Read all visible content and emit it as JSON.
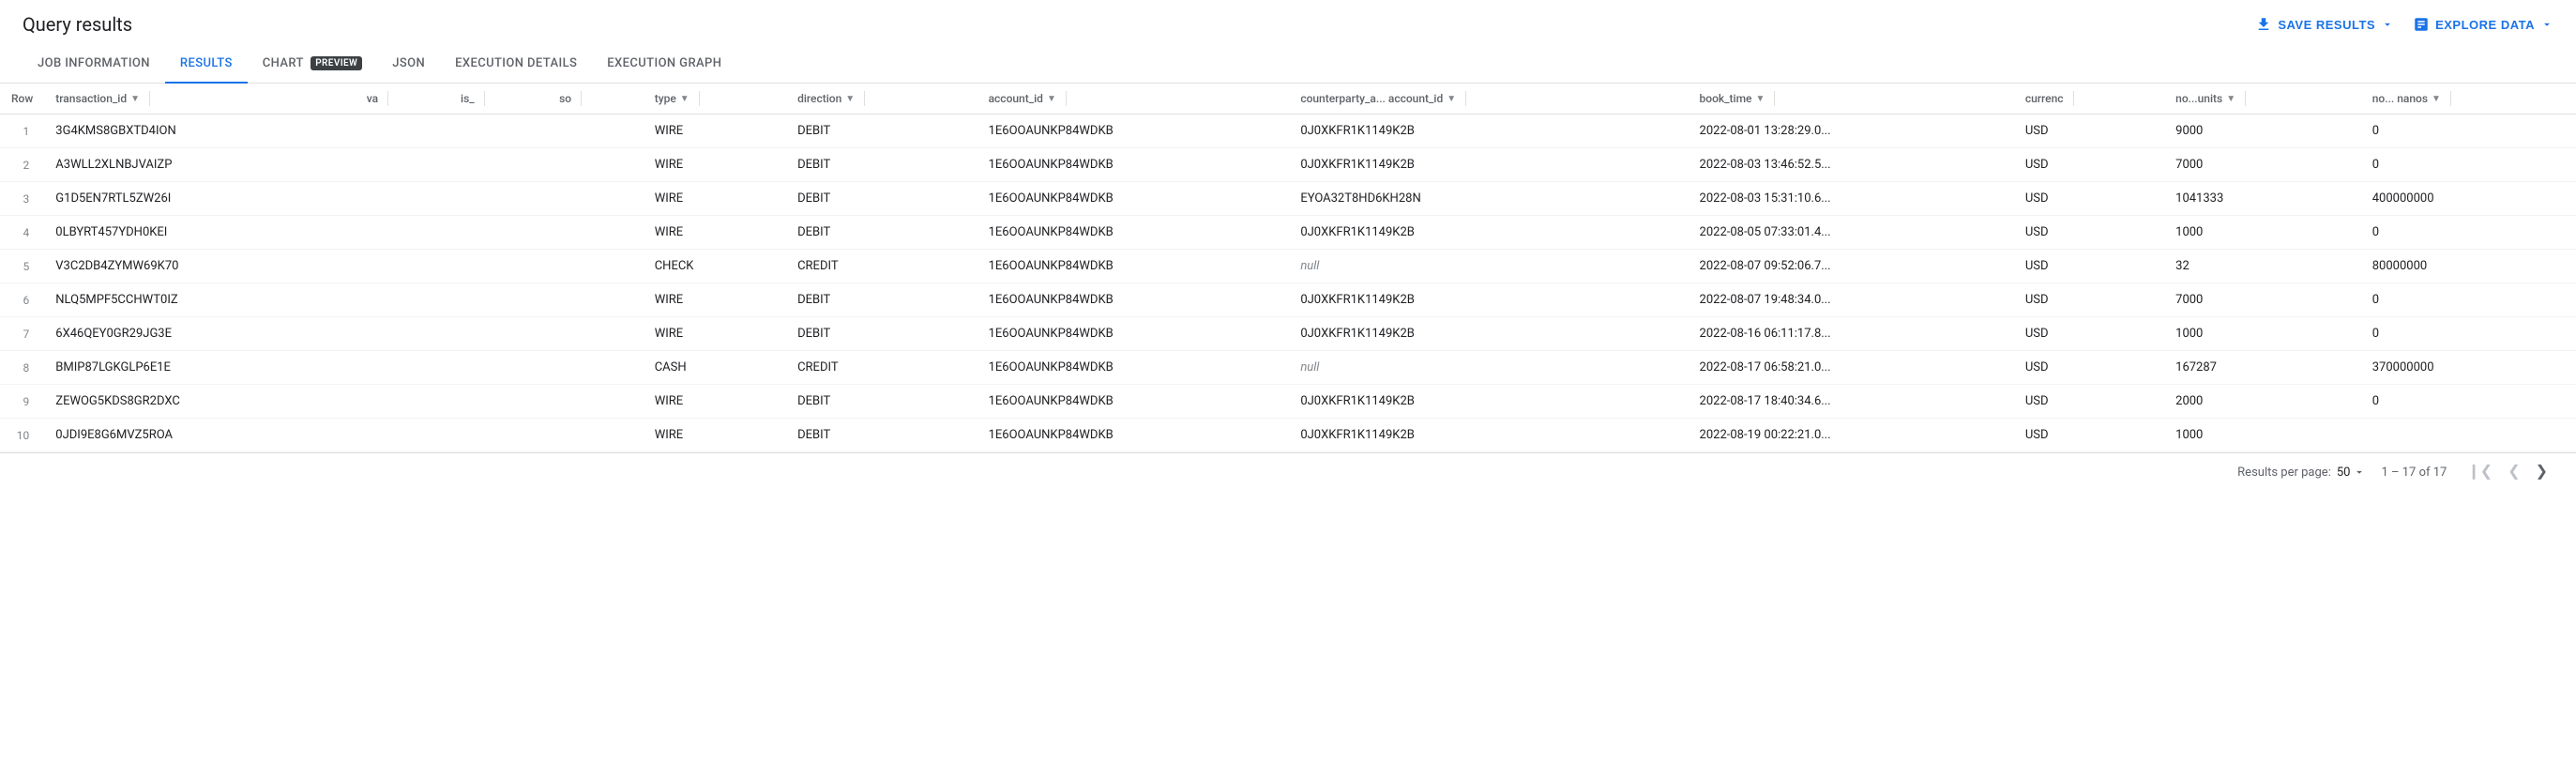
{
  "page": {
    "title": "Query results"
  },
  "header": {
    "save_results_label": "SAVE RESULTS",
    "explore_data_label": "EXPLORE DATA"
  },
  "tabs": [
    {
      "id": "job-information",
      "label": "JOB INFORMATION",
      "active": false,
      "preview": false
    },
    {
      "id": "results",
      "label": "RESULTS",
      "active": true,
      "preview": false
    },
    {
      "id": "chart",
      "label": "CHART",
      "active": false,
      "preview": true
    },
    {
      "id": "json",
      "label": "JSON",
      "active": false,
      "preview": false
    },
    {
      "id": "execution-details",
      "label": "EXECUTION DETAILS",
      "active": false,
      "preview": false
    },
    {
      "id": "execution-graph",
      "label": "EXECUTION GRAPH",
      "active": false,
      "preview": false
    }
  ],
  "table": {
    "columns": [
      {
        "id": "row",
        "label": "Row",
        "sortable": false
      },
      {
        "id": "transaction_id",
        "label": "transaction_id",
        "sortable": true
      },
      {
        "id": "va",
        "label": "va",
        "sortable": false
      },
      {
        "id": "is_",
        "label": "is_",
        "sortable": false
      },
      {
        "id": "so",
        "label": "so",
        "sortable": false
      },
      {
        "id": "type",
        "label": "type",
        "sortable": true
      },
      {
        "id": "direction",
        "label": "direction",
        "sortable": true
      },
      {
        "id": "account_id",
        "label": "account_id",
        "sortable": true
      },
      {
        "id": "counterparty_a_account_id",
        "label": "counterparty_a... account_id",
        "sortable": true
      },
      {
        "id": "book_time",
        "label": "book_time",
        "sortable": true
      },
      {
        "id": "currency",
        "label": "currenc",
        "sortable": false
      },
      {
        "id": "no_units",
        "label": "no...units",
        "sortable": true
      },
      {
        "id": "no_nanos",
        "label": "no... nanos",
        "sortable": true
      }
    ],
    "rows": [
      {
        "row": 1,
        "transaction_id": "3G4KMS8GBXTD4ION",
        "va": "",
        "is_": "",
        "so": "",
        "type": "WIRE",
        "direction": "DEBIT",
        "account_id": "1E6OOAUNKP84WDKB",
        "counterparty_a_account_id": "0J0XKFR1K1149K2B",
        "book_time": "2022-08-01 13:28:29.0...",
        "currency": "USD",
        "no_units": "9000",
        "no_nanos": "0"
      },
      {
        "row": 2,
        "transaction_id": "A3WLL2XLNBJVAIZP",
        "va": "",
        "is_": "",
        "so": "",
        "type": "WIRE",
        "direction": "DEBIT",
        "account_id": "1E6OOAUNKP84WDKB",
        "counterparty_a_account_id": "0J0XKFR1K1149K2B",
        "book_time": "2022-08-03 13:46:52.5...",
        "currency": "USD",
        "no_units": "7000",
        "no_nanos": "0"
      },
      {
        "row": 3,
        "transaction_id": "G1D5EN7RTL5ZW26I",
        "va": "",
        "is_": "",
        "so": "",
        "type": "WIRE",
        "direction": "DEBIT",
        "account_id": "1E6OOAUNKP84WDKB",
        "counterparty_a_account_id": "EYOA32T8HD6KH28N",
        "book_time": "2022-08-03 15:31:10.6...",
        "currency": "USD",
        "no_units": "1041333",
        "no_nanos": "400000000"
      },
      {
        "row": 4,
        "transaction_id": "0LBYRT457YDH0KEI",
        "va": "",
        "is_": "",
        "so": "",
        "type": "WIRE",
        "direction": "DEBIT",
        "account_id": "1E6OOAUNKP84WDKB",
        "counterparty_a_account_id": "0J0XKFR1K1149K2B",
        "book_time": "2022-08-05 07:33:01.4...",
        "currency": "USD",
        "no_units": "1000",
        "no_nanos": "0"
      },
      {
        "row": 5,
        "transaction_id": "V3C2DB4ZYMW69K70",
        "va": "",
        "is_": "",
        "so": "",
        "type": "CHECK",
        "direction": "CREDIT",
        "account_id": "1E6OOAUNKP84WDKB",
        "counterparty_a_account_id": "null",
        "book_time": "2022-08-07 09:52:06.7...",
        "currency": "USD",
        "no_units": "32",
        "no_nanos": "80000000"
      },
      {
        "row": 6,
        "transaction_id": "NLQ5MPF5CCHWT0IZ",
        "va": "",
        "is_": "",
        "so": "",
        "type": "WIRE",
        "direction": "DEBIT",
        "account_id": "1E6OOAUNKP84WDKB",
        "counterparty_a_account_id": "0J0XKFR1K1149K2B",
        "book_time": "2022-08-07 19:48:34.0...",
        "currency": "USD",
        "no_units": "7000",
        "no_nanos": "0"
      },
      {
        "row": 7,
        "transaction_id": "6X46QEY0GR29JG3E",
        "va": "",
        "is_": "",
        "so": "",
        "type": "WIRE",
        "direction": "DEBIT",
        "account_id": "1E6OOAUNKP84WDKB",
        "counterparty_a_account_id": "0J0XKFR1K1149K2B",
        "book_time": "2022-08-16 06:11:17.8...",
        "currency": "USD",
        "no_units": "1000",
        "no_nanos": "0"
      },
      {
        "row": 8,
        "transaction_id": "BMIP87LGKGLP6E1E",
        "va": "",
        "is_": "",
        "so": "",
        "type": "CASH",
        "direction": "CREDIT",
        "account_id": "1E6OOAUNKP84WDKB",
        "counterparty_a_account_id": "null",
        "book_time": "2022-08-17 06:58:21.0...",
        "currency": "USD",
        "no_units": "167287",
        "no_nanos": "370000000"
      },
      {
        "row": 9,
        "transaction_id": "ZEWOG5KDS8GR2DXC",
        "va": "",
        "is_": "",
        "so": "",
        "type": "WIRE",
        "direction": "DEBIT",
        "account_id": "1E6OOAUNKP84WDKB",
        "counterparty_a_account_id": "0J0XKFR1K1149K2B",
        "book_time": "2022-08-17 18:40:34.6...",
        "currency": "USD",
        "no_units": "2000",
        "no_nanos": "0"
      },
      {
        "row": 10,
        "transaction_id": "0JDI9E8G6MVZ5ROA",
        "va": "",
        "is_": "",
        "so": "",
        "type": "WIRE",
        "direction": "DEBIT",
        "account_id": "1E6OOAUNKP84WDKB",
        "counterparty_a_account_id": "0J0XKFR1K1149K2B",
        "book_time": "2022-08-19 00:22:21.0...",
        "currency": "USD",
        "no_units": "1000",
        "no_nanos": ""
      }
    ]
  },
  "footer": {
    "per_page_label": "Results per page:",
    "per_page_value": "50",
    "pagination_range": "1 – 17 of 17"
  }
}
